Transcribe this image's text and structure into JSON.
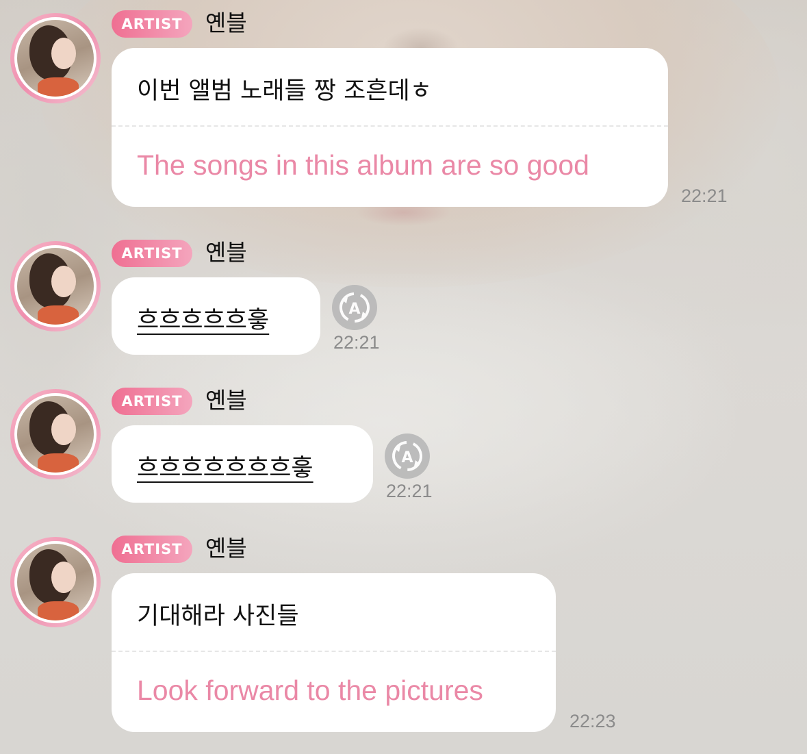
{
  "messages": [
    {
      "badge": "ARTIST",
      "sender": "옌블",
      "text": "이번 앨범 노래들 짱 조흔데ㅎ",
      "translation": "The songs in this album are so good",
      "time": "22:21"
    },
    {
      "badge": "ARTIST",
      "sender": "옌블",
      "text": "흐흐흐흐흐흫",
      "time": "22:21",
      "translate_icon": "translate-icon"
    },
    {
      "badge": "ARTIST",
      "sender": "옌블",
      "text": "흐흐흐흐흐흐흐흫",
      "time": "22:21",
      "translate_icon": "translate-icon"
    },
    {
      "badge": "ARTIST",
      "sender": "옌블",
      "text": "기대해라 사진들",
      "translation": "Look forward to the pictures",
      "time": "22:23"
    }
  ],
  "colors": {
    "badge_start": "#ef6f92",
    "badge_end": "#f4a5bd",
    "translation_text": "#ea88a6",
    "time_text": "#8b8b8b",
    "bubble": "#ffffff"
  }
}
